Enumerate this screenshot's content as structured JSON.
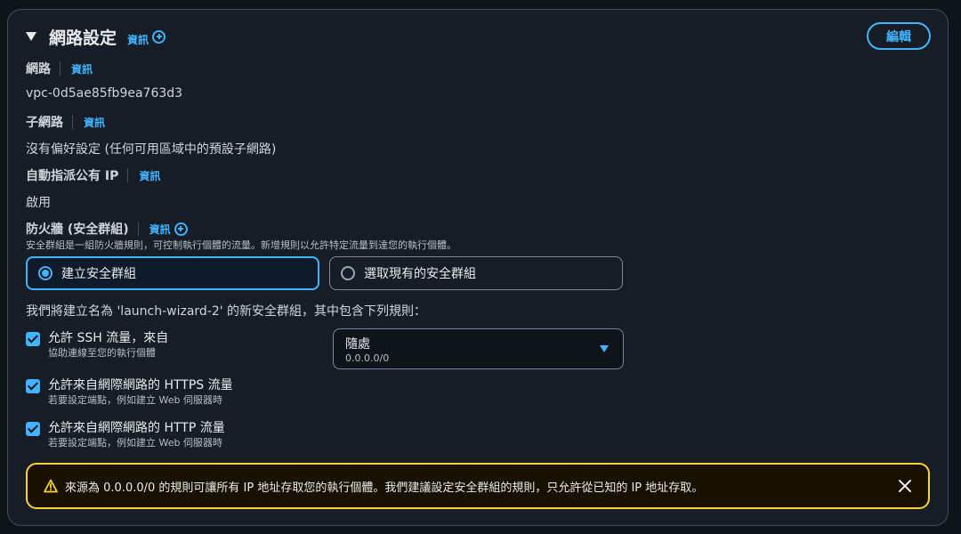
{
  "section": {
    "title": "網路設定",
    "info_label": "資訊",
    "edit_button": "編輯"
  },
  "fields": {
    "network": {
      "label": "網路",
      "info": "資訊",
      "value": "vpc-0d5ae85fb9ea763d3"
    },
    "subnet": {
      "label": "子網路",
      "info": "資訊",
      "value": "沒有偏好設定 (任何可用區域中的預設子網路)"
    },
    "public_ip": {
      "label": "自動指派公有 IP",
      "info": "資訊",
      "value": "啟用"
    },
    "firewall": {
      "label": "防火牆 (安全群組)",
      "info": "資訊",
      "description": "安全群組是一組防火牆規則，可控制執行個體的流量。新增規則以允許特定流量到達您的執行個體。"
    }
  },
  "security_group_options": [
    {
      "label": "建立安全群組",
      "selected": true
    },
    {
      "label": "選取現有的安全群組",
      "selected": false
    }
  ],
  "rules_intro": "我們將建立名為 'launch-wizard-2' 的新安全群組，其中包含下列規則：",
  "rules": [
    {
      "label": "允許 SSH 流量，來自",
      "description": "協助連線至您的執行個體",
      "checked": true
    },
    {
      "label": "允許來自網際網路的 HTTPS 流量",
      "description": "若要設定端點，例如建立 Web 伺服器時",
      "checked": true
    },
    {
      "label": "允許來自網際網路的 HTTP 流量",
      "description": "若要設定端點，例如建立 Web 伺服器時",
      "checked": true
    }
  ],
  "ssh_source": {
    "value": "隨處",
    "sub": "0.0.0.0/0"
  },
  "alert": {
    "text": "來源為 0.0.0.0/0 的規則可讓所有 IP 地址存取您的執行個體。我們建議設定安全群組的規則，只允許從已知的 IP 地址存取。"
  },
  "colors": {
    "accent": "#42b4ff",
    "warning": "#fbd332",
    "panel_bg": "#161d26"
  },
  "icons": [
    "caret-down-icon",
    "info-plus-icon",
    "radio-icon",
    "checkbox-check-icon",
    "dropdown-caret-icon",
    "warning-icon",
    "close-icon"
  ]
}
